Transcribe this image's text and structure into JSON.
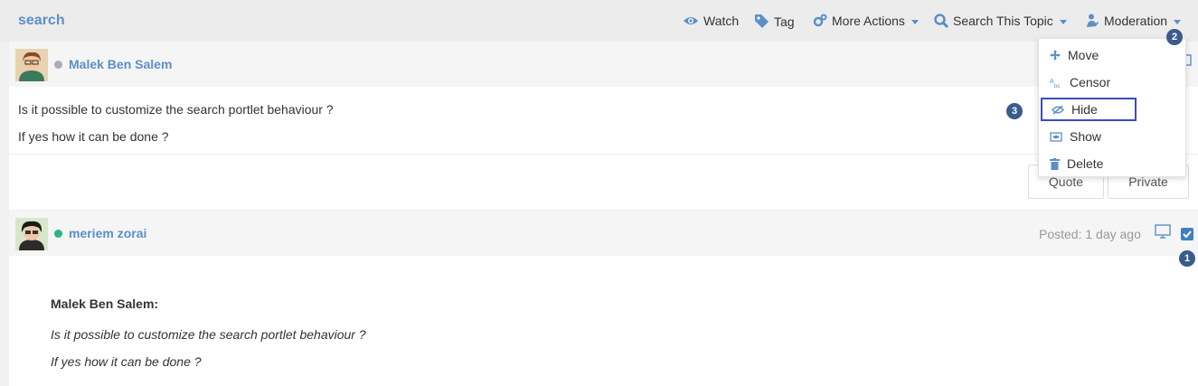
{
  "header": {
    "title": "search",
    "watch": "Watch",
    "tag": "Tag",
    "more_actions": "More Actions",
    "search_topic": "Search This Topic",
    "moderation": "Moderation"
  },
  "moderation_menu": {
    "items": [
      "Move",
      "Censor",
      "Hide",
      "Show",
      "Delete"
    ],
    "active": "Hide"
  },
  "posts": [
    {
      "author": "Malek Ben Salem",
      "lines": [
        "Is it possible to customize the search portlet behaviour ?",
        "If yes how it can be done ?"
      ],
      "buttons": [
        "Quote",
        "Private"
      ]
    },
    {
      "author": "meriem zorai",
      "posted": "Posted: 1 day ago",
      "quote_author": "Malek Ben Salem:",
      "quote_lines": [
        "Is it possible to customize the search portlet behaviour ?",
        "If yes how it can be done ?"
      ]
    }
  ],
  "badges": [
    "1",
    "2",
    "3"
  ],
  "colors": {
    "accent": "#5b8fc7",
    "badge": "#3a5c8c",
    "highlight": "#3b4cb8",
    "online": "#2db37f",
    "offline": "#aab"
  }
}
